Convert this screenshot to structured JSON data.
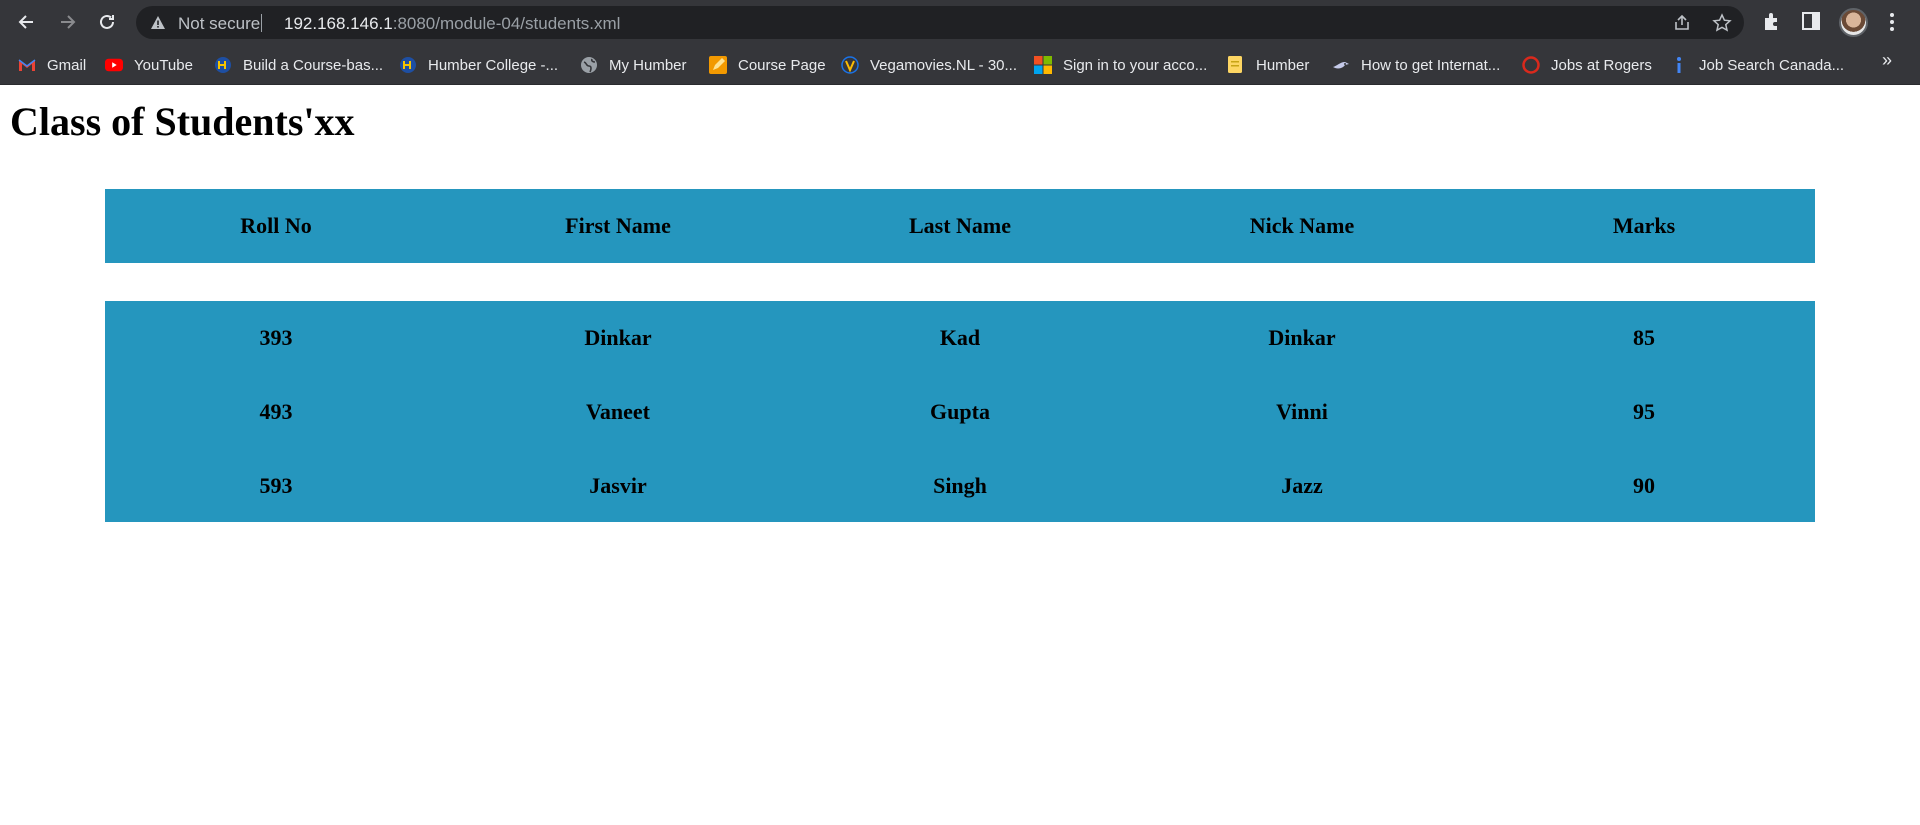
{
  "browser": {
    "security_label": "Not secure",
    "url_host": "192.168.146.1",
    "url_path": ":8080/module-04/students.xml",
    "bookmarks": [
      {
        "label": "Gmail",
        "icon": "gmail-icon"
      },
      {
        "label": "YouTube",
        "icon": "youtube-icon"
      },
      {
        "label": "Build a Course-bas...",
        "icon": "humber-icon"
      },
      {
        "label": "Humber College -...",
        "icon": "humber-icon"
      },
      {
        "label": "My Humber",
        "icon": "globe-icon"
      },
      {
        "label": "Course Page",
        "icon": "pencil-icon"
      },
      {
        "label": "Vegamovies.NL - 30...",
        "icon": "vegamovies-icon"
      },
      {
        "label": "Sign in to your acco...",
        "icon": "microsoft-icon"
      },
      {
        "label": "Humber",
        "icon": "note-icon"
      },
      {
        "label": "How to get Internat...",
        "icon": "bird-icon"
      },
      {
        "label": "Jobs at Rogers",
        "icon": "rogers-icon"
      },
      {
        "label": "Job Search Canada...",
        "icon": "info-icon"
      }
    ],
    "overflow_label": "»"
  },
  "page": {
    "title": "Class of Students'xx",
    "columns": [
      "Roll No",
      "First Name",
      "Last Name",
      "Nick Name",
      "Marks"
    ],
    "rows": [
      [
        "393",
        "Dinkar",
        "Kad",
        "Dinkar",
        "85"
      ],
      [
        "493",
        "Vaneet",
        "Gupta",
        "Vinni",
        "95"
      ],
      [
        "593",
        "Jasvir",
        "Singh",
        "Jazz",
        "90"
      ]
    ],
    "table_color": "#2596be"
  }
}
